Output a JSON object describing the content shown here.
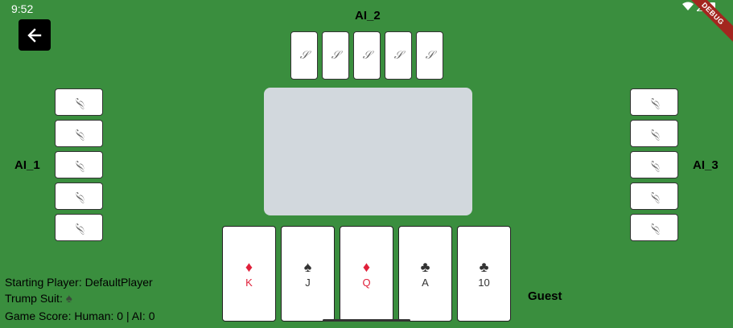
{
  "status": {
    "time": "9:52",
    "debug": "DEBUG"
  },
  "players": {
    "top": "AI_2",
    "left": "AI_1",
    "right": "AI_3",
    "bottom": "Guest"
  },
  "card_back_mark": "𝒮",
  "hand": [
    {
      "suit": "♦",
      "rank": "K",
      "color": "red"
    },
    {
      "suit": "♠",
      "rank": "J",
      "color": "black"
    },
    {
      "suit": "♦",
      "rank": "Q",
      "color": "red"
    },
    {
      "suit": "♣",
      "rank": "A",
      "color": "black"
    },
    {
      "suit": "♣",
      "rank": "10",
      "color": "black"
    }
  ],
  "info": {
    "starting_player": "Starting Player: DefaultPlayer",
    "trump_label": "Trump Suit:",
    "trump_suit": "♠",
    "score": "Game Score: Human: 0 | AI: 0"
  },
  "colors": {
    "table": "#3a8e3e",
    "play_area": "#d2d8dd",
    "red_suit": "#e0203a"
  }
}
